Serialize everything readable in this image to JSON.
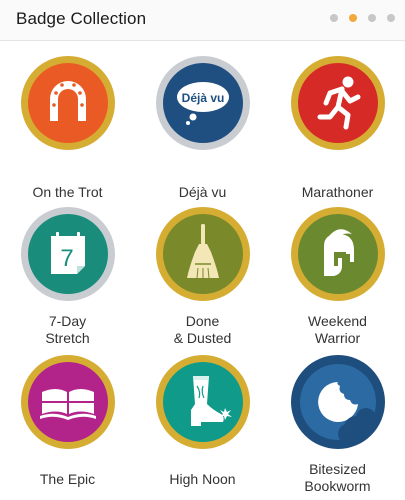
{
  "header": {
    "title": "Badge Collection",
    "page_indicator": {
      "pages": 4,
      "active_page": 2
    }
  },
  "colors": {
    "gold_ring": "#d6ad33",
    "silver_ring": "#c9cdd2",
    "active_dot": "#f0a93a",
    "inactive_dot": "#c7c7c7"
  },
  "badges": [
    {
      "label": "On the Trot",
      "icon": "horseshoe-icon",
      "fill": "#ea5a24",
      "ring": "gold"
    },
    {
      "label": "Déjà vu",
      "icon": "speech-bubble-icon",
      "bubble_text": "Déjà vu",
      "fill": "#1f4f80",
      "ring": "silver"
    },
    {
      "label": "Marathoner",
      "icon": "runner-icon",
      "fill": "#d62a27",
      "ring": "gold"
    },
    {
      "label": "7-Day\nStretch",
      "icon": "calendar-icon",
      "calendar_text": "7",
      "fill": "#1a8c7c",
      "ring": "silver"
    },
    {
      "label": "Done\n& Dusted",
      "icon": "broom-icon",
      "fill": "#7a8a2a",
      "ring": "gold"
    },
    {
      "label": "Weekend\nWarrior",
      "icon": "spartan-helmet-icon",
      "fill": "#6b8a2f",
      "ring": "gold"
    },
    {
      "label": "The Epic",
      "icon": "open-book-icon",
      "fill": "#b3248b",
      "ring": "gold"
    },
    {
      "label": "High Noon",
      "icon": "cowboy-boot-icon",
      "fill": "#0f9a8a",
      "ring": "gold"
    },
    {
      "label": "Bitesized\nBookworm",
      "icon": "bitten-cookie-icon",
      "fill": "#1e4e7e",
      "ring": "navy"
    }
  ]
}
